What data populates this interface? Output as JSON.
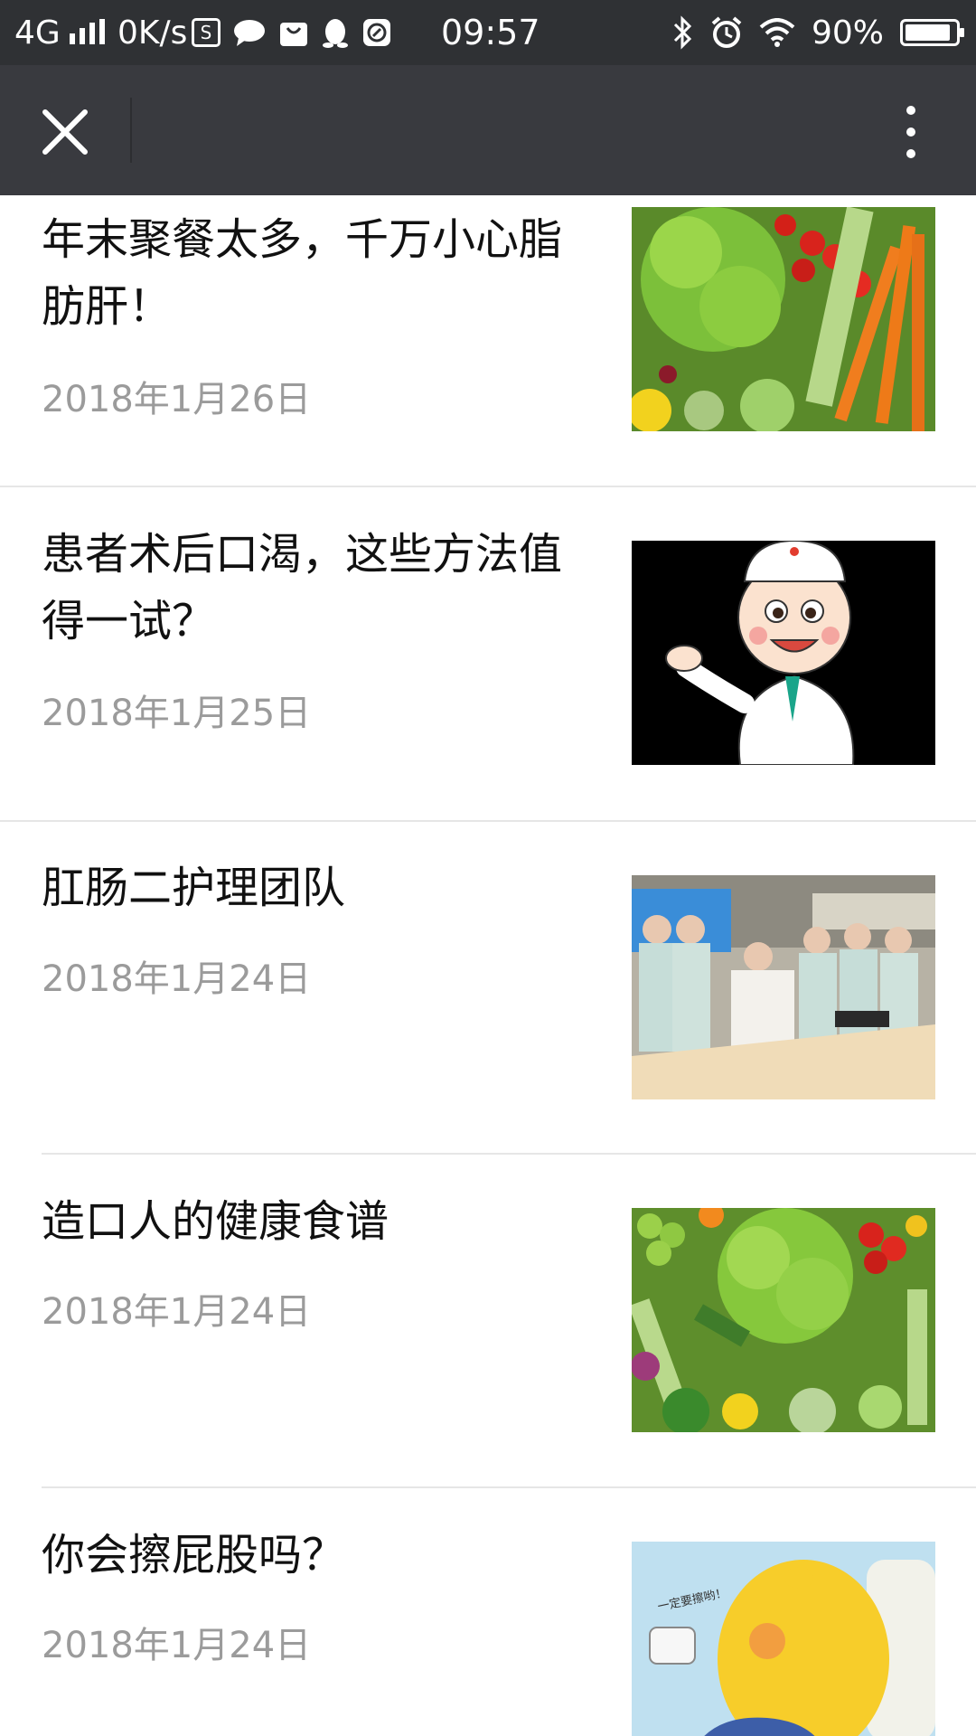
{
  "status_bar": {
    "network": "4G",
    "speed": "0K/s",
    "time": "09:57",
    "battery_percent": "90%",
    "battery_level": 0.9
  },
  "nav": {
    "close_icon": "close-icon",
    "more_icon": "more-vertical-icon"
  },
  "articles": [
    {
      "title": "年末聚餐太多，千万小心脂肪肝！",
      "date": "2018年1月26日",
      "thumbnail": "vegetables"
    },
    {
      "title": "患者术后口渴，这些方法值得一试？",
      "date": "2018年1月25日",
      "thumbnail": "cartoon-doctor"
    },
    {
      "title": "肛肠二护理团队",
      "date": "2018年1月24日",
      "thumbnail": "nursing-team-photo"
    },
    {
      "title": "造口人的健康食谱",
      "date": "2018年1月24日",
      "thumbnail": "vegetables"
    },
    {
      "title": "你会擦屁股吗？",
      "date": "2018年1月24日",
      "thumbnail": "cartoon-toilet",
      "thumbnail_text": "一定要擦哟！"
    }
  ]
}
